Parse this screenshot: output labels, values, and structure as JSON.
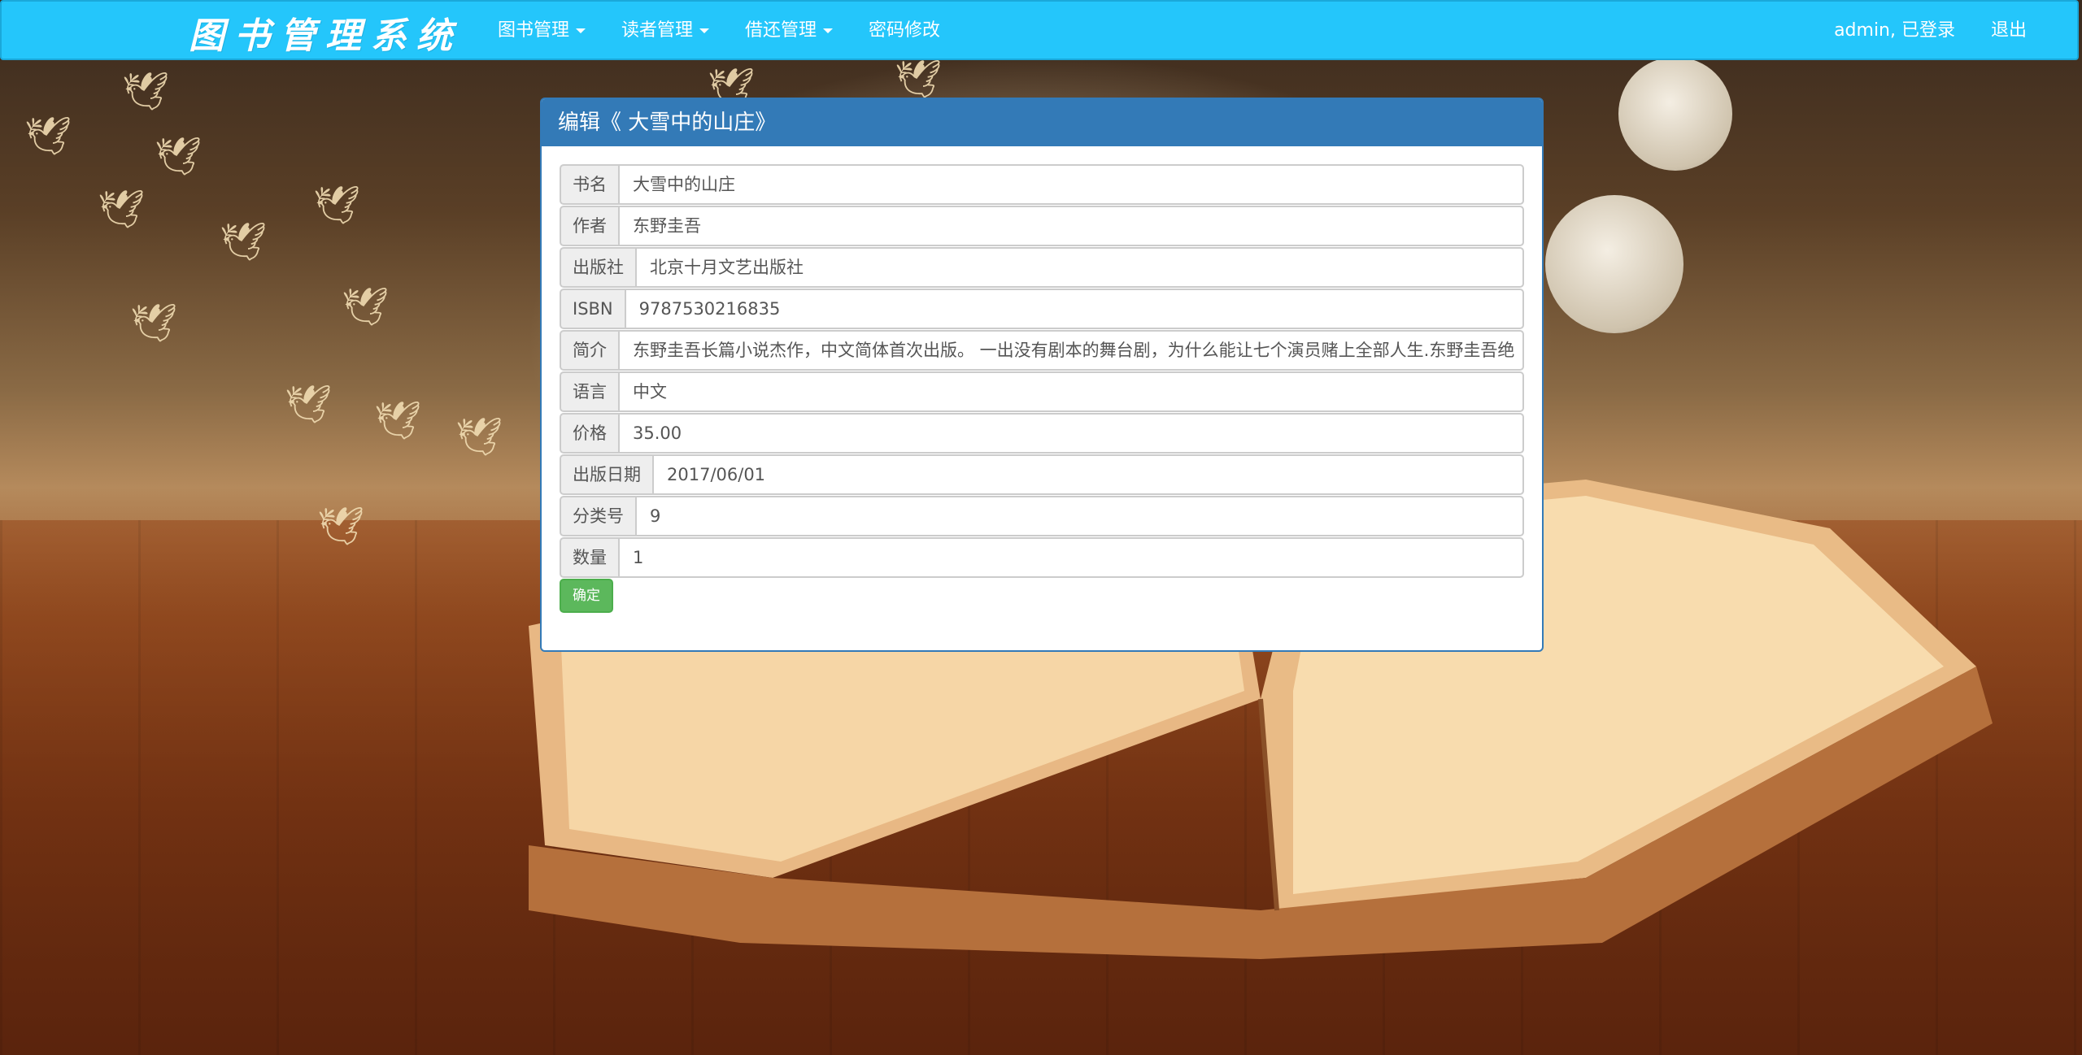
{
  "navbar": {
    "brand": "图书管理系统",
    "menu": [
      {
        "label": "图书管理",
        "dropdown": true
      },
      {
        "label": "读者管理",
        "dropdown": true
      },
      {
        "label": "借还管理",
        "dropdown": true
      },
      {
        "label": "密码修改",
        "dropdown": false
      }
    ],
    "user_status": "admin, 已登录",
    "logout": "退出"
  },
  "panel": {
    "title": "编辑《 大雪中的山庄》",
    "fields": [
      {
        "label": "书名",
        "value": "大雪中的山庄"
      },
      {
        "label": "作者",
        "value": "东野圭吾"
      },
      {
        "label": "出版社",
        "value": "北京十月文艺出版社"
      },
      {
        "label": "ISBN",
        "value": "9787530216835"
      },
      {
        "label": "简介",
        "value": "东野圭吾长篇小说杰作，中文简体首次出版。 一出没有剧本的舞台剧，为什么能让七个演员赌上全部人生.东野圭吾绝"
      },
      {
        "label": "语言",
        "value": "中文"
      },
      {
        "label": "价格",
        "value": "35.00"
      },
      {
        "label": "出版日期",
        "value": "2017/06/01"
      },
      {
        "label": "分类号",
        "value": "9"
      },
      {
        "label": "数量",
        "value": "1"
      }
    ],
    "submit_label": "确定"
  },
  "colors": {
    "navbar": "#24c6fb",
    "panel_header": "#337ab7",
    "button": "#5cb85c"
  },
  "icons": [
    "caret-down-icon"
  ]
}
